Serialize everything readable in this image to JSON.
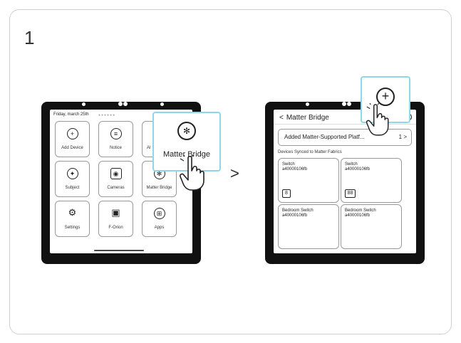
{
  "step": {
    "number": "1"
  },
  "left_screen": {
    "date": "Friday, march 25th",
    "tiles": [
      {
        "label": "Add Device",
        "icon": "plus-circle-icon",
        "glyph": "+"
      },
      {
        "label": "Notice",
        "icon": "notice-icon",
        "glyph": "≡"
      },
      {
        "label": "Al",
        "icon": "automation-icon",
        "glyph": ""
      },
      {
        "label": "Subject",
        "icon": "scene-icon",
        "glyph": "✦"
      },
      {
        "label": "Cameras",
        "icon": "camera-icon",
        "glyph": "◉"
      },
      {
        "label": "Matter Bridge",
        "icon": "matter-bridge-icon",
        "glyph": "✻"
      },
      {
        "label": "Settings",
        "icon": "gear-icon",
        "glyph": "⚙"
      },
      {
        "label": "F-Orion",
        "icon": "robot-icon",
        "glyph": "▣"
      },
      {
        "label": "Apps",
        "icon": "apps-icon",
        "glyph": "⊞"
      }
    ]
  },
  "popup_bridge": {
    "label": "Matter Bridge",
    "icon": "matter-bridge-icon",
    "glyph": "✻"
  },
  "arrow": ">",
  "right_screen": {
    "back": "<",
    "title": "Matter Bridge",
    "added_row": "Added Matter-Supported Platf...",
    "added_count": "1 >",
    "synced_label": "Devices Synced to Matter Fabrics",
    "devices": [
      {
        "name": "Switch",
        "id": "a40000106fb",
        "box": "8"
      },
      {
        "name": "Switch",
        "id": "a40000106fb",
        "box": "88"
      },
      {
        "name": "Bedroom Switch",
        "id": "a40000106fb",
        "box": ""
      },
      {
        "name": "Bedroom Switch",
        "id": "a40000106fb",
        "box": ""
      }
    ]
  },
  "popup_plus": {
    "icon": "plus-circle-icon",
    "glyph": "+"
  },
  "colors": {
    "highlight_border": "#8fd6e8",
    "device_frame": "#111111"
  }
}
